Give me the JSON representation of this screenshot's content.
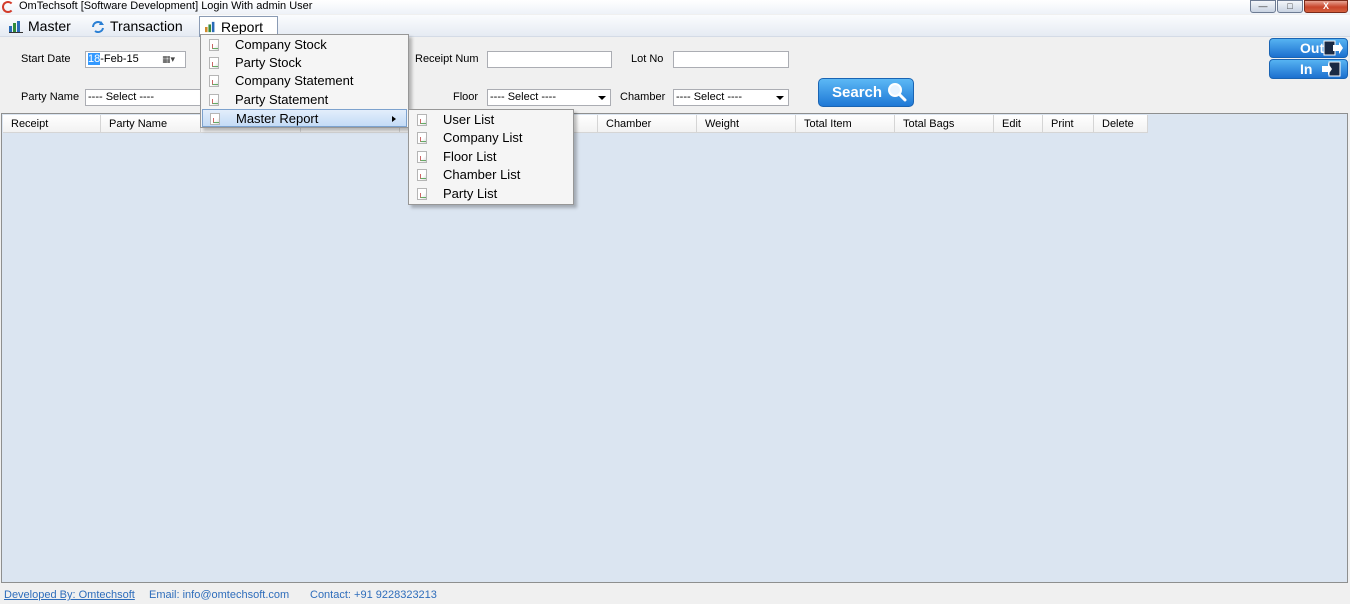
{
  "window": {
    "title": "OmTechsoft [Software Development] Login With admin User",
    "minimize": "—",
    "maximize": "□",
    "close": "X"
  },
  "menubar": {
    "master": "Master",
    "transaction": "Transaction",
    "report": "Report"
  },
  "filters": {
    "start_date_label": "Start Date",
    "start_date_day": "18",
    "start_date_rest": "-Feb-15",
    "receipt_num_label": "Receipt Num",
    "receipt_num_value": "",
    "lot_no_label": "Lot No",
    "lot_no_value": "",
    "party_name_label": "Party Name",
    "party_name_value": "---- Select ----",
    "floor_label": "Floor",
    "floor_value": "---- Select ----",
    "chamber_label": "Chamber",
    "chamber_value": "---- Select ----"
  },
  "buttons": {
    "search": "Search",
    "out": "Out",
    "in": "In"
  },
  "grid": {
    "columns": [
      "Receipt",
      "Party Name",
      "",
      "",
      "",
      "",
      "Chamber",
      "Weight",
      "Total Item",
      "Total Bags",
      "Edit",
      "Print",
      "Delete"
    ]
  },
  "report_menu": {
    "items": [
      "Company Stock",
      "Party Stock",
      "Company Statement",
      "Party Statement",
      "Master Report"
    ],
    "submenu": [
      "User List",
      "Company List",
      "Floor List",
      "Chamber List",
      "Party List"
    ]
  },
  "footer": {
    "developed_by": "Developed By: Omtechsoft",
    "email": "Email: info@omtechsoft.com",
    "contact": "Contact: +91 9228323213"
  },
  "colors": {
    "grid_bg": "#dbe5f1",
    "button_blue": "#1e78d6",
    "footer_link": "#2e6dbb"
  }
}
